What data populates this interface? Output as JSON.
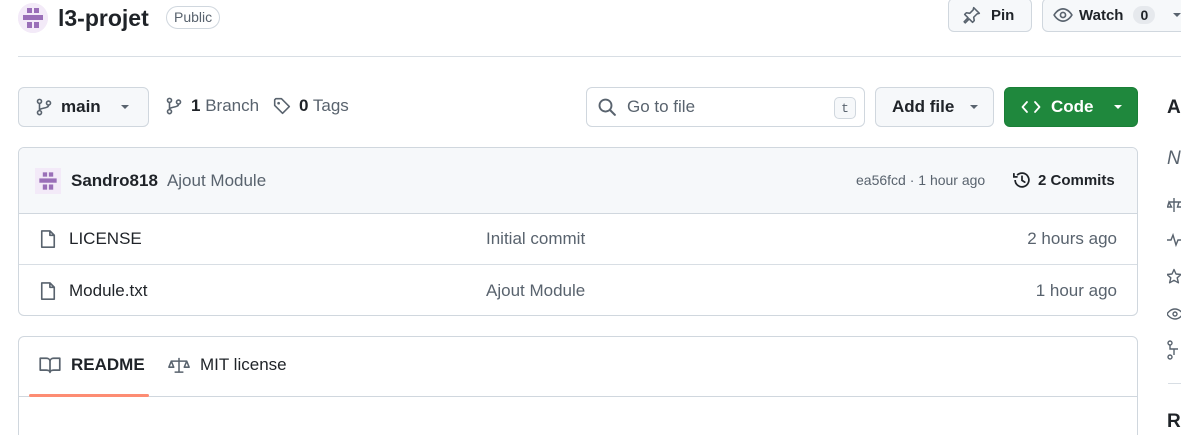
{
  "repo": {
    "name": "l3-projet",
    "visibility": "Public"
  },
  "header_actions": {
    "pin_label": "Pin",
    "watch_label": "Watch",
    "watch_count": "0"
  },
  "toolbar": {
    "branch_name": "main",
    "branch_count": "1",
    "branch_word": "Branch",
    "tag_count": "0",
    "tag_word": "Tags",
    "search_placeholder": "Go to file",
    "search_shortcut": "t",
    "add_file_label": "Add file",
    "code_label": "Code"
  },
  "latest_commit": {
    "author": "Sandro818",
    "message": "Ajout Module",
    "meta": "ea56fcd · 1 hour ago",
    "commits_label": "2 Commits"
  },
  "files": [
    {
      "name": "LICENSE",
      "message": "Initial commit",
      "time": "2 hours ago"
    },
    {
      "name": "Module.txt",
      "message": "Ajout Module",
      "time": "1 hour ago"
    }
  ],
  "readme_tabs": {
    "readme": "README",
    "license": "MIT license"
  },
  "sidebar_partial": {
    "about_letter": "A",
    "no_desc_letter": "N",
    "releases_letters": "Re"
  },
  "colors": {
    "accent_green": "#1f883d",
    "tab_underline": "#fd8c73"
  },
  "icons": [
    "identicon-avatar",
    "pin-icon",
    "eye-icon",
    "caret-down-icon",
    "git-branch-icon",
    "tag-icon",
    "search-icon",
    "code-icon",
    "history-icon",
    "file-icon",
    "book-icon",
    "law-icon"
  ]
}
